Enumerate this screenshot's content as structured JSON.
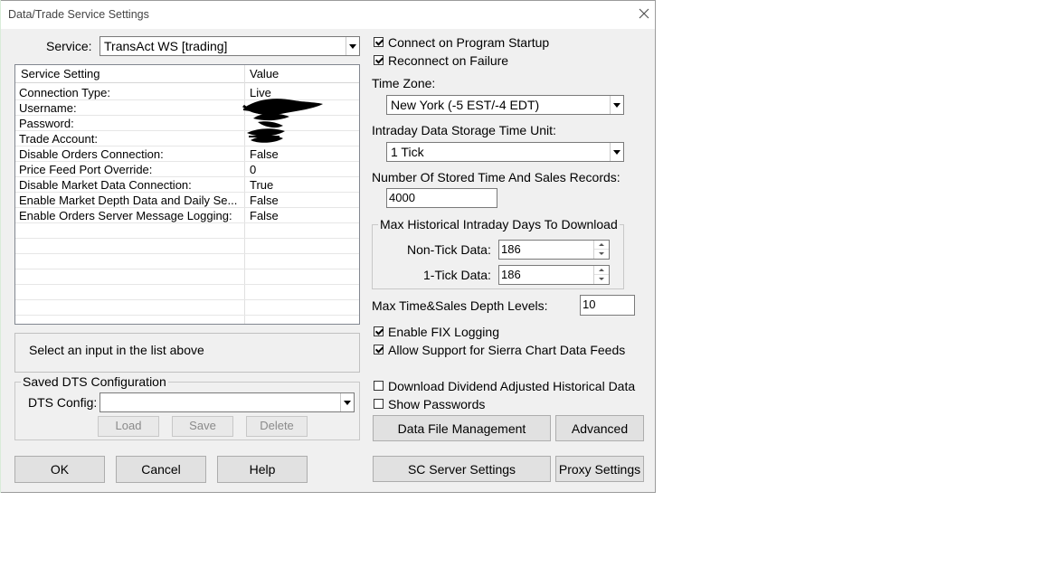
{
  "window": {
    "title": "Data/Trade Service Settings"
  },
  "service": {
    "label": "Service:",
    "value": "TransAct WS   [trading]"
  },
  "grid": {
    "headers": [
      "Service Setting",
      "Value"
    ],
    "rows": [
      {
        "setting": "Connection Type:",
        "value": "Live"
      },
      {
        "setting": "Username:",
        "value": ""
      },
      {
        "setting": "Password:",
        "value": ""
      },
      {
        "setting": "Trade Account:",
        "value": ""
      },
      {
        "setting": "Disable Orders Connection:",
        "value": "False"
      },
      {
        "setting": "Price Feed Port Override:",
        "value": "0"
      },
      {
        "setting": "Disable Market Data Connection:",
        "value": "True"
      },
      {
        "setting": "Enable Market Depth Data and Daily Se...",
        "value": "False"
      },
      {
        "setting": "Enable Orders Server Message Logging:",
        "value": "False"
      }
    ]
  },
  "description": "Select an input in the list above",
  "dts": {
    "group_title": "Saved DTS Configuration",
    "config_label": "DTS Config:",
    "config_value": "",
    "load": "Load",
    "save": "Save",
    "delete": "Delete"
  },
  "buttons": {
    "ok": "OK",
    "cancel": "Cancel",
    "help": "Help",
    "data_file_management": "Data File Management",
    "advanced": "Advanced",
    "sc_server_settings": "SC Server Settings",
    "proxy_settings": "Proxy Settings"
  },
  "options": {
    "connect_on_startup": {
      "label": "Connect on Program Startup",
      "checked": true
    },
    "reconnect_on_failure": {
      "label": "Reconnect on Failure",
      "checked": true
    },
    "enable_fix_logging": {
      "label": "Enable FIX Logging",
      "checked": true
    },
    "allow_sierra_feeds": {
      "label": "Allow Support for Sierra Chart Data Feeds",
      "checked": true
    },
    "download_dividend": {
      "label": "Download Dividend Adjusted Historical Data",
      "checked": false
    },
    "show_passwords": {
      "label": "Show Passwords",
      "checked": false
    }
  },
  "timezone": {
    "label": "Time Zone:",
    "value": "New York (-5 EST/-4 EDT)"
  },
  "storage_unit": {
    "label": "Intraday Data Storage Time Unit:",
    "value": "1 Tick"
  },
  "ts_records": {
    "label": "Number Of Stored Time And Sales Records:",
    "value": "4000"
  },
  "historical": {
    "group_title": "Max Historical Intraday Days To Download",
    "non_tick_label": "Non-Tick Data:",
    "non_tick_value": "186",
    "one_tick_label": "1-Tick Data:",
    "one_tick_value": "186"
  },
  "depth": {
    "label": "Max Time&Sales Depth Levels:",
    "value": "10"
  },
  "icons": {
    "close": "close-icon",
    "dropdown": "chevron-down-icon"
  }
}
